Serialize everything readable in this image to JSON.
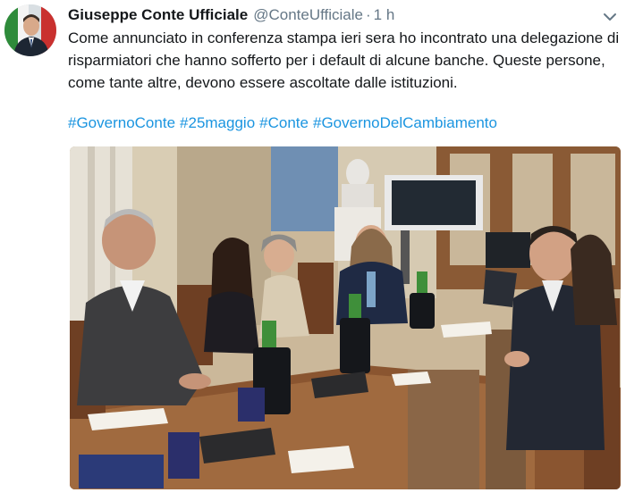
{
  "tweet": {
    "author_name": "Giuseppe Conte Ufficiale",
    "handle": "@ConteUfficiale",
    "separator": "·",
    "time": "1 h",
    "text": "Come annunciato in conferenza stampa ieri sera ho incontrato una delegazione di risparmiatori che hanno sofferto per i default di alcune banche. Queste persone, come tante altre, devono essere ascoltate dalle istituzioni.",
    "hashtags": [
      "#GovernoConte",
      "#25maggio",
      "#Conte",
      "#GovernoDelCambiamento"
    ],
    "link_color": "#1b95e0",
    "icons": {
      "more": "chevron-down-icon"
    }
  }
}
